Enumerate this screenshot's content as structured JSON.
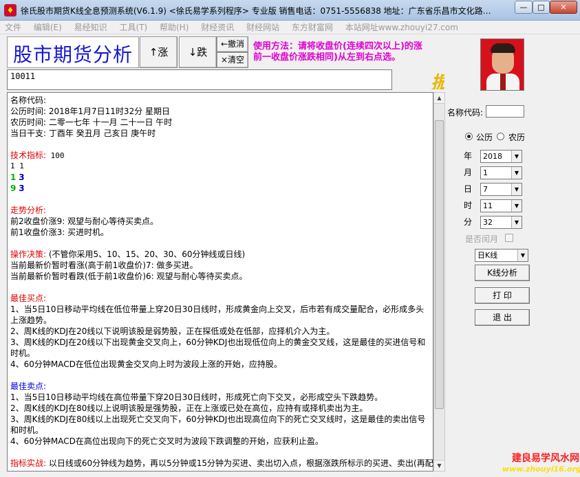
{
  "window": {
    "title": "徐氏股市期货K线全息预测系统(V6.1.9)  <徐氏易学系列程序> 专业版  销售电话：0751-5556838  地址：广东省乐昌市文化路B...",
    "min_glyph": "—",
    "max_glyph": "□",
    "close_glyph": "✕"
  },
  "menu": [
    "文件",
    "编辑(E)",
    "易经知识",
    "工具(T)",
    "帮助(H)",
    "财经资讯",
    "财经网站",
    "东方财富网",
    "本站网址www.zhouyi27.com"
  ],
  "toolbar": {
    "heading": "股市期货分析",
    "rise_label": "↑涨",
    "fall_label": "↓跌",
    "undo_label": "←撤消",
    "clear_label": "×清空"
  },
  "usage": {
    "line1": "使用方法：请将收盘价(连续四次以上)的涨",
    "line2": "前一收盘价涨跌相同)从左到右点选。"
  },
  "code_input_value": "10011",
  "marquee_char": "振",
  "report": {
    "name_line": "名称代码:",
    "solar_line": "公历时间: 2018年1月7日11时32分 星期日",
    "lunar_line": "农历时间: 二零一七年 十一月 二十一日 午时",
    "ganzhi_line": "当日干支: 丁酉年 癸丑月 己亥日 庚午时",
    "tech_label": "技术指标:",
    "tech_value": " 100",
    "seq_line": "1 1",
    "g1": "1",
    "b1": "3",
    "g2": "9",
    "b2": "3",
    "trend_label": "走势分析:",
    "trend_1": "前2收盘价涨9: 观望与耐心等待买卖点。",
    "trend_2": "前1收盘价涨3: 买进时机。",
    "op_label": "操作决策:",
    "op_value": " (不管你采用5、10、15、20、30、60分钟线或日线)",
    "op_1": "当前最新价暂时看涨(高于前1收盘价)7: 做多买进。",
    "op_2": "当前最新价暂时看跌(低于前1收盘价)6: 观望与耐心等待买卖点。",
    "buy_label": "最佳买点:",
    "buy_1": "1、当5日10日移动平均线在低位带量上穿20日30日线时，形成黄金向上交叉，后市若有成交量配合，必形成多头上涨趋势。",
    "buy_2": "2、周K线的KDJ在20线以下说明该股是弱势股，正在探低或处在低部，应择机介入为主。",
    "buy_3": "3、周K线的KDJ在20线以下出现黄金交叉向上，60分钟KDJ也出现低位向上的黄金交叉线，这是最佳的买进信号和时机。",
    "buy_4": "4、60分钟MACD在低位出现黄金交叉向上时为波段上涨的开始，应持股。",
    "sell_label": "最佳卖点:",
    "sell_1": "1、当5日10日移动平均线在高位带量下穿20日30日线时，形成死亡向下交叉，必形成空头下跌趋势。",
    "sell_2": "2、周K线的KDJ在80线以上说明该股是强势股，正在上涨或已处在高位，应持有或择机卖出为主。",
    "sell_3": "3、周K线的KDJ在80线以上出现死亡交叉向下，60分钟KDJ也出现高位向下的死亡交叉线时，这是最佳的卖出信号和时机。",
    "sell_4": "4、60分钟MACD在高位出现向下的死亡交叉时为波段下跌调整的开始，应获利止盈。",
    "practice_label": "指标实战:",
    "practice_value": " 以日线或60分钟线为趋势，再以5分钟或15分钟为买进、卖出切入点，根据涨跌所标示的买进、卖出(再配"
  },
  "side": {
    "code_label": "名称代码:",
    "solar_label": "公历",
    "lunar_label": "农历",
    "year_label": "年",
    "month_label": "月",
    "day_label": "日",
    "hour_label": "时",
    "minute_label": "分",
    "year": "2018",
    "month": "1",
    "day": "7",
    "hour": "11",
    "minute": "32",
    "leap_label": "是否闰月",
    "period": "日K线",
    "analyze_label": "K线分析",
    "print_label": "打 印",
    "exit_label": "退 出"
  },
  "watermark": {
    "line1": "建良易学风水网",
    "line2": "www.zhouyi16.org"
  }
}
